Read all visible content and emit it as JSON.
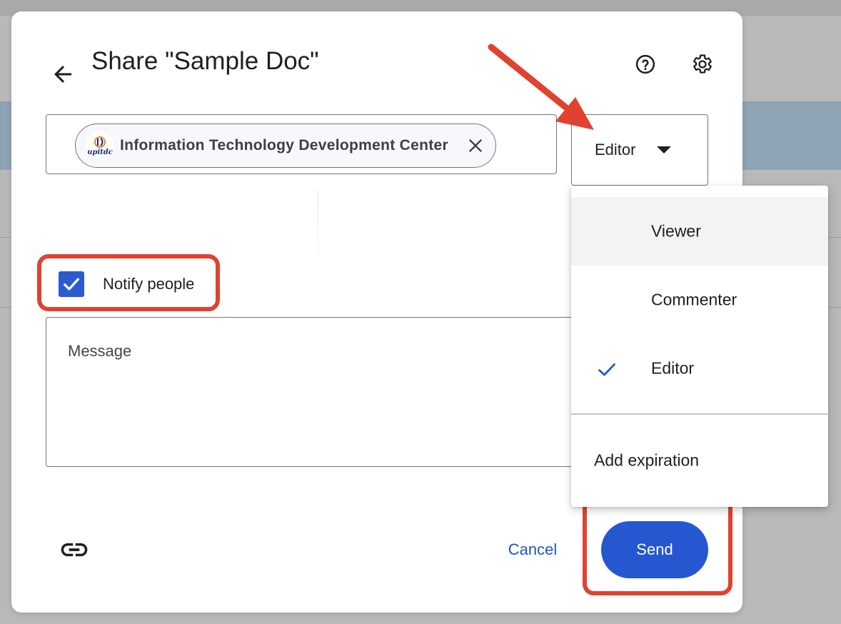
{
  "dialog": {
    "title": "Share \"Sample Doc\"",
    "back_icon": "arrow-left-icon",
    "help_icon": "help-circle-icon",
    "settings_icon": "gear-icon"
  },
  "people": {
    "chip": {
      "label": "Information Technology Development Center",
      "avatar_icon": "organization-logo-icon",
      "remove_icon": "close-icon"
    }
  },
  "role": {
    "selected": "Editor",
    "caret_icon": "caret-down-icon"
  },
  "role_menu": {
    "items": [
      {
        "label": "Viewer",
        "checked": false,
        "hovered": true
      },
      {
        "label": "Commenter",
        "checked": false,
        "hovered": false
      },
      {
        "label": "Editor",
        "checked": true,
        "hovered": false
      }
    ],
    "extra": "Add expiration"
  },
  "notify": {
    "label": "Notify people",
    "checked": true
  },
  "message": {
    "placeholder": "Message"
  },
  "footer": {
    "link_icon": "link-icon",
    "cancel_label": "Cancel",
    "send_label": "Send"
  },
  "annotations": {
    "highlight_color": "#e0422f",
    "primary_color": "#2557d0"
  }
}
